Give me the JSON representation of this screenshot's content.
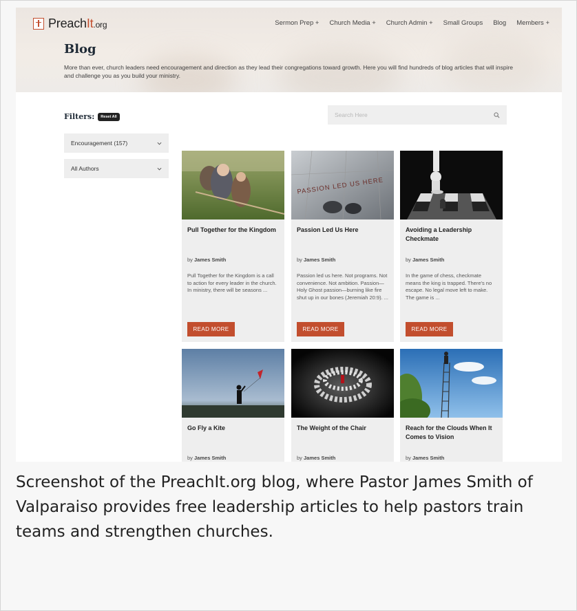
{
  "header": {
    "logo": {
      "main": "Preach",
      "accent": "It",
      "suffix": ".org"
    },
    "nav": [
      "Sermon Prep +",
      "Church Media +",
      "Church Admin +",
      "Small Groups",
      "Blog",
      "Members +"
    ]
  },
  "page": {
    "title": "Blog",
    "intro": "More than ever, church leaders need encouragement and direction as they lead their congregations toward growth. Here you will find hundreds of blog articles that will inspire and challenge you as you build your ministry."
  },
  "filters": {
    "label": "Filters:",
    "reset": "Reset All",
    "category": "Encouragement (157)",
    "authors": "All Authors"
  },
  "search": {
    "placeholder": "Search Here"
  },
  "posts": [
    {
      "title": "Pull Together for the Kingdom",
      "by": "by",
      "author": "James Smith",
      "excerpt": "Pull Together for the Kingdom  is a call to action for every leader in the church. In ministry, there will be seasons ...",
      "button": "READ MORE"
    },
    {
      "title": "Passion Led Us Here",
      "image_text": "PASSION LED US HERE",
      "by": "by",
      "author": "James Smith",
      "excerpt": "Passion led us here.  Not programs. Not convenience. Not ambition. Passion—Holy Ghost passion—burning like fire shut up in our bones (Jeremiah 20:9). ...",
      "button": "READ MORE"
    },
    {
      "title": "Avoiding a Leadership Checkmate",
      "by": "by",
      "author": "James Smith",
      "excerpt": "In the game of chess,  checkmate  means the king is trapped. There's no escape. No legal move left to make. The game is ...",
      "button": "READ MORE"
    },
    {
      "title": "Go Fly a Kite",
      "by": "by",
      "author": "James Smith"
    },
    {
      "title": "The Weight of the Chair",
      "by": "by",
      "author": "James Smith"
    },
    {
      "title": "Reach for the Clouds When It Comes to Vision",
      "by": "by",
      "author": "James Smith"
    }
  ],
  "caption": "Screenshot of the PreachIt.org blog, where Pastor James Smith of Valparaiso provides free leadership articles to help pastors train teams and strengthen churches.",
  "colors": {
    "accent": "#c24e2e",
    "title": "#1f2a36",
    "card_bg": "#eeeeee"
  }
}
